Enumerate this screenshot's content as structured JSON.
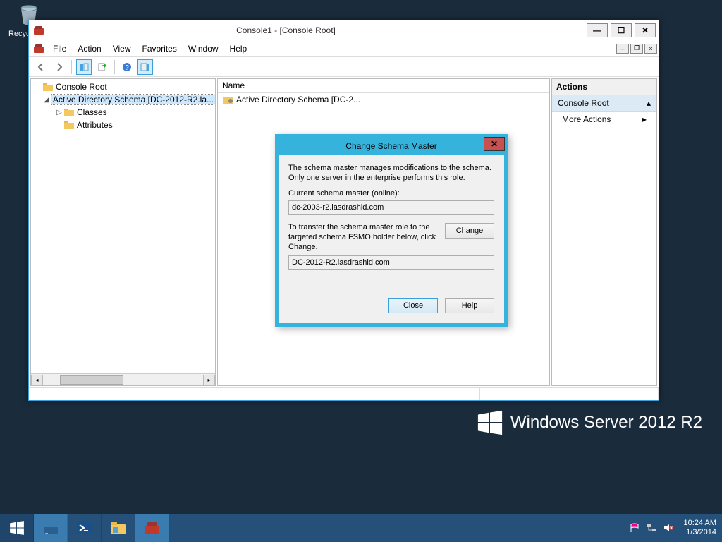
{
  "desktop": {
    "recycle_label": "Recycle Bin",
    "watermark": "Windows Server 2012 R2"
  },
  "mmc": {
    "title": "Console1 - [Console Root]",
    "menu": [
      "File",
      "Action",
      "View",
      "Favorites",
      "Window",
      "Help"
    ],
    "tree": {
      "root": "Console Root",
      "ad_schema": "Active Directory Schema [DC-2012-R2.la...",
      "classes": "Classes",
      "attributes": "Attributes"
    },
    "list": {
      "header": "Name",
      "item0": "Active Directory Schema [DC-2..."
    },
    "actions": {
      "title": "Actions",
      "section": "Console Root",
      "more": "More Actions"
    }
  },
  "dialog": {
    "title": "Change Schema Master",
    "intro": "The schema master manages modifications to the schema. Only one server in the enterprise performs this role.",
    "current_label": "Current schema master (online):",
    "current_value": "dc-2003-r2.lasdrashid.com",
    "transfer_text": "To transfer the schema master role to the targeted schema FSMO holder below, click Change.",
    "target_value": "DC-2012-R2.lasdrashid.com",
    "change_btn": "Change",
    "close_btn": "Close",
    "help_btn": "Help"
  },
  "taskbar": {
    "time": "10:24 AM",
    "date": "1/3/2014"
  }
}
